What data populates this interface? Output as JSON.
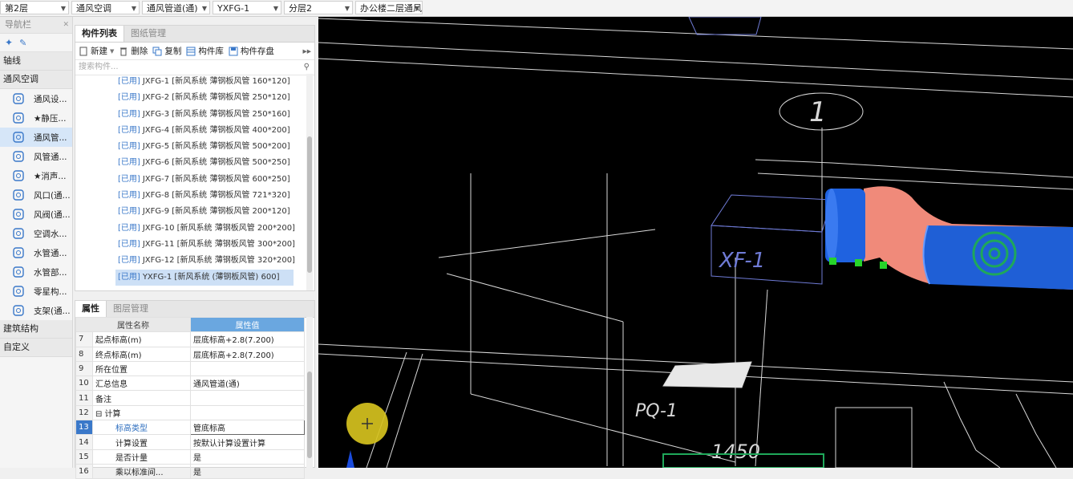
{
  "topbar": {
    "floor": "第2层",
    "discipline": "通风空调",
    "category": "通风管道(通)",
    "component": "YXFG-1",
    "layer": "分层2",
    "drawing": "办公楼二层通风"
  },
  "nav": {
    "title": "导航栏",
    "sections": [
      "轴线",
      "通风空调",
      "建筑结构",
      "自定义"
    ],
    "items": [
      "通风设...",
      "★静压...",
      "通风管...",
      "风管通...",
      "★消声...",
      "风口(通...",
      "风阀(通...",
      "空调水...",
      "水管通...",
      "水管部...",
      "零星构...",
      "支架(通..."
    ]
  },
  "component_panel": {
    "tabs": [
      "构件列表",
      "图纸管理"
    ],
    "toolbar": [
      "新建",
      "删除",
      "复制",
      "构件库",
      "构件存盘"
    ],
    "search_placeholder": "搜索构件...",
    "rows": [
      {
        "tag": "[已用]",
        "name": "JXFG-1 [新风系统 薄钢板风管 160*120]"
      },
      {
        "tag": "[已用]",
        "name": "JXFG-2 [新风系统 薄钢板风管 250*120]"
      },
      {
        "tag": "[已用]",
        "name": "JXFG-3 [新风系统 薄钢板风管 250*160]"
      },
      {
        "tag": "[已用]",
        "name": "JXFG-4 [新风系统 薄钢板风管 400*200]"
      },
      {
        "tag": "[已用]",
        "name": "JXFG-5 [新风系统 薄钢板风管 500*200]"
      },
      {
        "tag": "[已用]",
        "name": "JXFG-6 [新风系统 薄钢板风管 500*250]"
      },
      {
        "tag": "[已用]",
        "name": "JXFG-7 [新风系统 薄钢板风管 600*250]"
      },
      {
        "tag": "[已用]",
        "name": "JXFG-8 [新风系统 薄钢板风管 721*320]"
      },
      {
        "tag": "[已用]",
        "name": "JXFG-9 [新风系统 薄钢板风管 200*120]"
      },
      {
        "tag": "[已用]",
        "name": "JXFG-10 [新风系统 薄钢板风管 200*200]"
      },
      {
        "tag": "[已用]",
        "name": "JXFG-11 [新风系统 薄钢板风管 300*200]"
      },
      {
        "tag": "[已用]",
        "name": "JXFG-12 [新风系统 薄钢板风管 320*200]"
      },
      {
        "tag": "[已用]",
        "name": "YXFG-1 [新风系统 (薄钢板风管) 600]"
      }
    ]
  },
  "property_panel": {
    "tabs": [
      "属性",
      "图层管理"
    ],
    "col_name": "属性名称",
    "col_value": "属性值",
    "rows": [
      {
        "n": "7",
        "name": "起点标高(m)",
        "value": "层底标高+2.8(7.200)"
      },
      {
        "n": "8",
        "name": "终点标高(m)",
        "value": "层底标高+2.8(7.200)"
      },
      {
        "n": "9",
        "name": "所在位置",
        "value": ""
      },
      {
        "n": "10",
        "name": "汇总信息",
        "value": "通风管道(通)"
      },
      {
        "n": "11",
        "name": "备注",
        "value": ""
      },
      {
        "n": "12",
        "name": "⊟ 计算",
        "value": ""
      },
      {
        "n": "13",
        "name": "标高类型",
        "value": "管底标高"
      },
      {
        "n": "14",
        "name": "计算设置",
        "value": "按默认计算设置计算"
      },
      {
        "n": "15",
        "name": "是否计量",
        "value": "是"
      },
      {
        "n": "16",
        "name": "乘以标准间...",
        "value": "是"
      }
    ]
  },
  "canvas": {
    "labels": [
      "1",
      "XF-1",
      "PQ-1",
      "1450"
    ]
  },
  "colors": {
    "accent": "#3a78c9",
    "duct": "#1f5fd6",
    "fitting": "#f08a7a"
  }
}
